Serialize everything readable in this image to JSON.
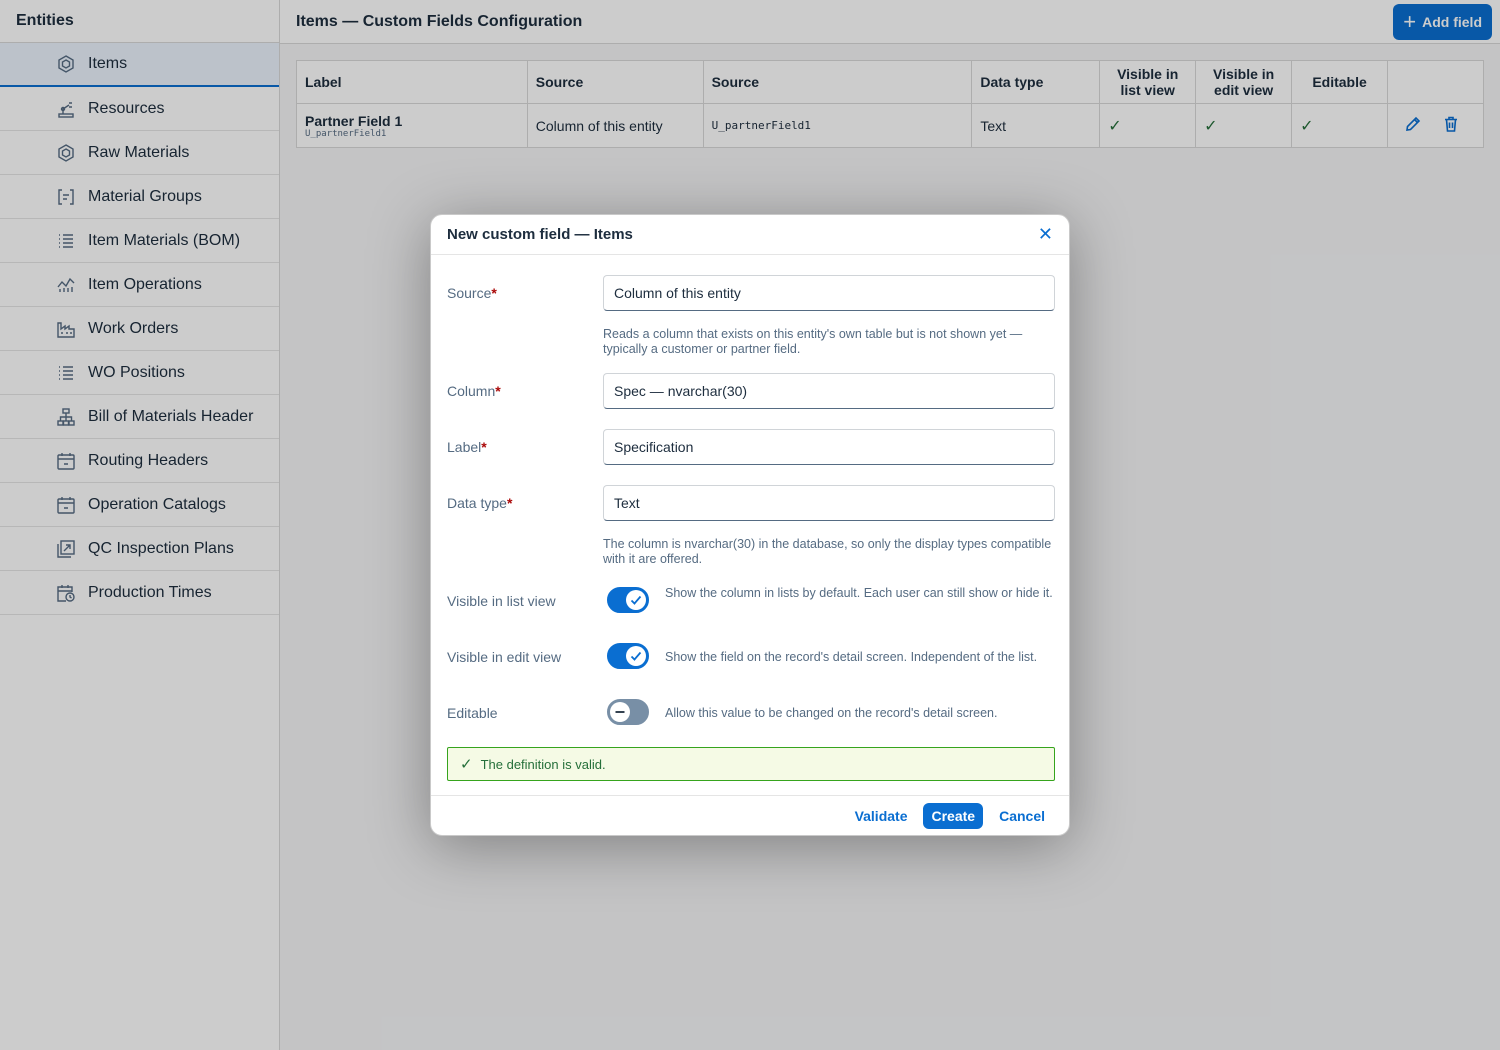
{
  "sidebar": {
    "title": "Entities",
    "items": [
      {
        "label": "Items",
        "icon": "cube-icon"
      },
      {
        "label": "Resources",
        "icon": "robot-arm-icon"
      },
      {
        "label": "Raw Materials",
        "icon": "cube-icon"
      },
      {
        "label": "Material Groups",
        "icon": "bracket-list-icon"
      },
      {
        "label": "Item Materials (BOM)",
        "icon": "list-icon"
      },
      {
        "label": "Item Operations",
        "icon": "line-chart-icon"
      },
      {
        "label": "Work Orders",
        "icon": "factory-icon"
      },
      {
        "label": "WO Positions",
        "icon": "list-icon"
      },
      {
        "label": "Bill of Materials Header",
        "icon": "hierarchy-icon"
      },
      {
        "label": "Routing Headers",
        "icon": "calendar-icon"
      },
      {
        "label": "Operation Catalogs",
        "icon": "calendar-icon"
      },
      {
        "label": "QC Inspection Plans",
        "icon": "chart-square-icon"
      },
      {
        "label": "Production Times",
        "icon": "calendar-clock-icon"
      }
    ]
  },
  "header": {
    "title": "Items — Custom Fields Configuration",
    "add_label": "Add field"
  },
  "table": {
    "columns": [
      "Label",
      "Source",
      "Source",
      "Data type",
      "Visible in list view",
      "Visible in edit view",
      "Editable"
    ],
    "rows": [
      {
        "label": "Partner Field 1",
        "sublabel": "U_partnerField1",
        "source": "Column of this entity",
        "source_field": "U_partnerField1",
        "data_type": "Text",
        "check_mark": "✓"
      }
    ]
  },
  "dialog": {
    "title": "New custom field — Items",
    "source_label": "Source",
    "source_value": "Column of this entity",
    "source_hint": "Reads a column that exists on this entity's own table but is not shown yet — typically a customer or partner field.",
    "column_label": "Column",
    "column_value": "Spec — nvarchar(30)",
    "label_label": "Label",
    "label_value": "Specification",
    "datatype_label": "Data type",
    "datatype_value": "Text",
    "datatype_hint": "The column is nvarchar(30) in the database, so only the display types compatible with it are offered.",
    "list_label": "Visible in list view",
    "list_desc": "Show the column in lists by default. Each user can still show or hide it.",
    "edit_label": "Visible in edit view",
    "edit_desc": "Show the field on the record's detail screen. Independent of the list.",
    "editable_label": "Editable",
    "editable_desc": "Allow this value to be changed on the record's detail screen.",
    "valid_message": "The definition is valid.",
    "validate_label": "Validate",
    "create_label": "Create",
    "cancel_label": "Cancel"
  },
  "colors": {
    "accent": "#0a6ed1",
    "success": "#256f3a",
    "valid_bg": "#f5fae5"
  }
}
